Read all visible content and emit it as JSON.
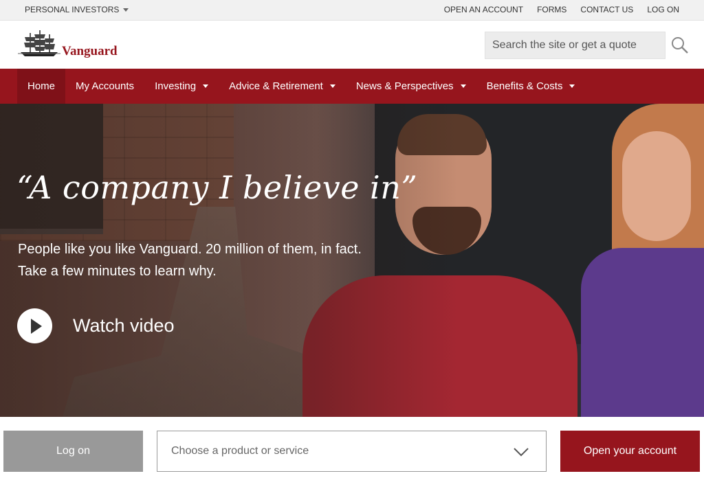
{
  "utility": {
    "audience_label": "PERSONAL INVESTORS",
    "links": [
      "OPEN AN ACCOUNT",
      "FORMS",
      "CONTACT US",
      "LOG ON"
    ]
  },
  "header": {
    "logo_text": "Vanguard",
    "search_placeholder": "Search the site or get a quote",
    "search_icon": "magnifier-icon"
  },
  "nav": {
    "items": [
      {
        "label": "Home"
      },
      {
        "label": "My Accounts"
      },
      {
        "label": "Investing"
      },
      {
        "label": "Advice & Retirement"
      },
      {
        "label": "News & Perspectives"
      },
      {
        "label": "Benefits & Costs"
      }
    ]
  },
  "hero": {
    "quote": "“A company I believe in”",
    "subtitle": "People like you like Vanguard. 20 million of them, in fact. Take a few minutes to learn why.",
    "watch_label": "Watch video"
  },
  "bottom": {
    "login_label": "Log on",
    "select_placeholder": "Choose a product or service",
    "open_label": "Open your account"
  },
  "colors": {
    "brand": "#96151d",
    "utility_bg": "#f1f1f1",
    "login_bg": "#999999"
  }
}
